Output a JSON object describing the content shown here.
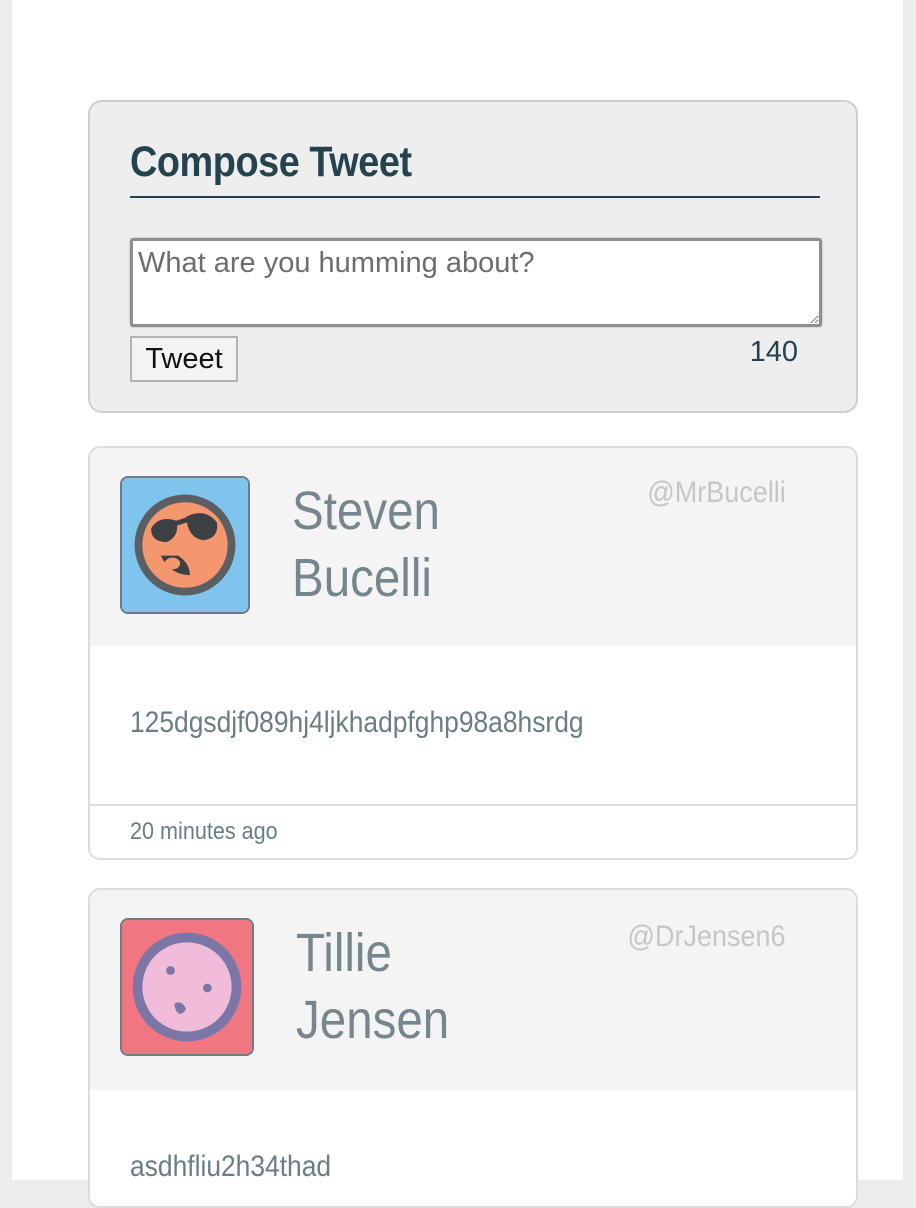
{
  "compose": {
    "title": "Compose Tweet",
    "placeholder": "What are you humming about?",
    "value": "",
    "button_label": "Tweet",
    "char_count": "140"
  },
  "tweets": [
    {
      "name_first": "Steven",
      "name_last": "Bucelli",
      "handle": "@MrBucelli",
      "text": "125dgsdjf089hj4ljkhadpfghp98a8hsrdg",
      "timestamp": "20 minutes ago",
      "avatar": {
        "icon": "sunglasses-face-icon",
        "background": "#7fc4ec",
        "face": "#f4966e"
      }
    },
    {
      "name_first": "Tillie",
      "name_last": "Jensen",
      "handle": "@DrJensen6",
      "text": "asdhfliu2h34thad",
      "avatar": {
        "icon": "surprised-face-icon",
        "background": "#f07782",
        "face": "#f1bcd9"
      }
    }
  ],
  "colors": {
    "primary_dark": "#25434f",
    "muted_text": "#75878d",
    "handle": "#c6c6c6"
  }
}
